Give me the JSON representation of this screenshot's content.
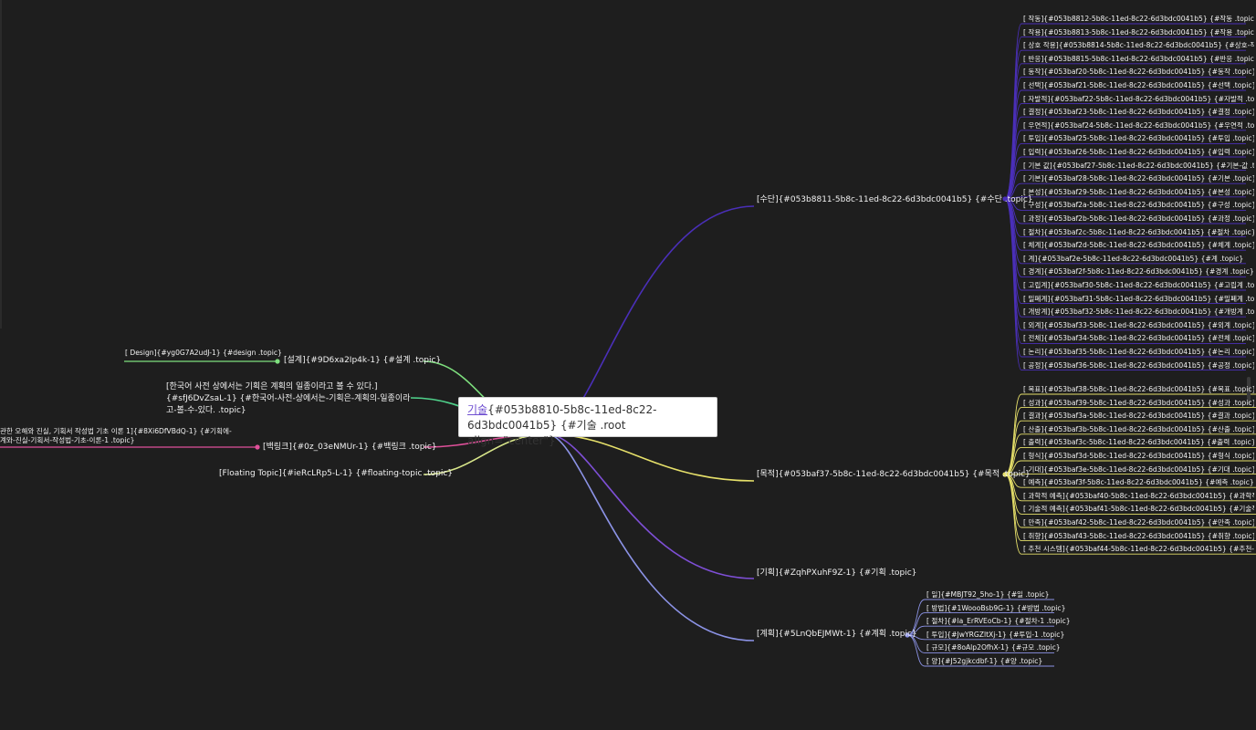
{
  "root": {
    "link_text": "기술",
    "rest": "{#053b8810-5b8c-11ed-8c22-6d3bdc0041b5} {#기술 .root align=\"center\"}"
  },
  "branches": {
    "sudan": "[수단]{#053b8811-5b8c-11ed-8c22-6d3bdc0041b5} {#수단 .topic}",
    "mokjeok": "[목적]{#053baf37-5b8c-11ed-8c22-6d3bdc0041b5} {#목적 .topic}",
    "gihoek": "[기획]{#ZqhPXuhF9Z-1} {#기획 .topic}",
    "gyehoek": "[계획]{#5LnQbEJMWt-1} {#계획 .topic}",
    "seolgye": "[설계]{#9D6xa2Ip4k-1} {#설계 .topic}",
    "design": "[ Design]{#yg0G7A2udJ-1} {#design .topic}",
    "note_line1": "[한국어 사전 상에서는 기획은 계획의 일종이라고 볼 수 있다.]",
    "note_line2": "{#sfJ6DvZsaL-1} {#한국어-사전-상에서는-기획은-계획의-일종이라",
    "note_line3": "고-볼-수-있다. .topic}",
    "baekring": "[백링크]{#0z_03eNMUr-1} {#백링크 .topic}",
    "baek_child1": "관한 오해와 진실, 기획서 작성법 기초 이론 1]{#8Xi6DfVBdQ-1} {#기획에-",
    "baek_child2": "계와-진실-기획서-작성법-기초-이론-1 .topic}",
    "floating": "[Floating Topic]{#ieRcLRp5-L-1} {#floating-topic .topic}"
  },
  "sudan_children": [
    "[ 작동]{#053b8812-5b8c-11ed-8c22-6d3bdc0041b5} {#작동 .topic}",
    "[ 작용]{#053b8813-5b8c-11ed-8c22-6d3bdc0041b5} {#작용 .topic}",
    "[ 상호 작용]{#053b8814-5b8c-11ed-8c22-6d3bdc0041b5} {#상호-작용 .tc",
    "[ 반응]{#053b8815-5b8c-11ed-8c22-6d3bdc0041b5} {#반응 .topic}",
    "[ 동작]{#053baf20-5b8c-11ed-8c22-6d3bdc0041b5} {#동작 .topic}",
    "[ 선택]{#053baf21-5b8c-11ed-8c22-6d3bdc0041b5} {#선택 .topic}",
    "[ 자발적]{#053baf22-5b8c-11ed-8c22-6d3bdc0041b5} {#자발적 .topic}",
    "[ 결정]{#053baf23-5b8c-11ed-8c22-6d3bdc0041b5} {#결정 .topic}",
    "[ 우연적]{#053baf24-5b8c-11ed-8c22-6d3bdc0041b5} {#우연적 .topic}",
    "[ 투입]{#053baf25-5b8c-11ed-8c22-6d3bdc0041b5} {#투입 .topic}",
    "[ 입력]{#053baf26-5b8c-11ed-8c22-6d3bdc0041b5} {#입력 .topic}",
    "[ 기본 값]{#053baf27-5b8c-11ed-8c22-6d3bdc0041b5} {#기본-값 .topic}",
    "[ 기본]{#053baf28-5b8c-11ed-8c22-6d3bdc0041b5} {#기본 .topic}",
    "[ 본성]{#053baf29-5b8c-11ed-8c22-6d3bdc0041b5} {#본성 .topic}",
    "[ 구성]{#053baf2a-5b8c-11ed-8c22-6d3bdc0041b5} {#구성 .topic}",
    "[ 과정]{#053baf2b-5b8c-11ed-8c22-6d3bdc0041b5} {#과정 .topic}",
    "[ 절차]{#053baf2c-5b8c-11ed-8c22-6d3bdc0041b5} {#절차 .topic}",
    "[ 체계]{#053baf2d-5b8c-11ed-8c22-6d3bdc0041b5} {#체계 .topic}",
    "[ 계]{#053baf2e-5b8c-11ed-8c22-6d3bdc0041b5} {#계 .topic}",
    "[ 경계]{#053baf2f-5b8c-11ed-8c22-6d3bdc0041b5} {#경계 .topic}",
    "[ 고립계]{#053baf30-5b8c-11ed-8c22-6d3bdc0041b5} {#고립계 .topic}",
    "[ 밀폐계]{#053baf31-5b8c-11ed-8c22-6d3bdc0041b5} {#밀폐계 .topic}",
    "[ 개방계]{#053baf32-5b8c-11ed-8c22-6d3bdc0041b5} {#개방계 .topic}",
    "[ 외계]{#053baf33-5b8c-11ed-8c22-6d3bdc0041b5} {#외계 .topic}",
    "[ 전체]{#053baf34-5b8c-11ed-8c22-6d3bdc0041b5} {#전체 .topic}",
    "[ 논리]{#053baf35-5b8c-11ed-8c22-6d3bdc0041b5} {#논리 .topic}",
    "[ 공정]{#053baf36-5b8c-11ed-8c22-6d3bdc0041b5} {#공정 .topic}"
  ],
  "mokjeok_children": [
    "[ 목표]{#053baf38-5b8c-11ed-8c22-6d3bdc0041b5} {#목표 .topic}",
    "[ 성과]{#053baf39-5b8c-11ed-8c22-6d3bdc0041b5} {#성과 .topic}",
    "[ 결과]{#053baf3a-5b8c-11ed-8c22-6d3bdc0041b5} {#결과 .topic}",
    "[ 산출]{#053baf3b-5b8c-11ed-8c22-6d3bdc0041b5} {#산출 .topic}",
    "[ 출력]{#053baf3c-5b8c-11ed-8c22-6d3bdc0041b5} {#출력 .topic}",
    "[ 형식]{#053baf3d-5b8c-11ed-8c22-6d3bdc0041b5} {#형식 .topic}",
    "[ 기대]{#053baf3e-5b8c-11ed-8c22-6d3bdc0041b5} {#기대 .topic}",
    "[ 예측]{#053baf3f-5b8c-11ed-8c22-6d3bdc0041b5} {#예측 .topic}",
    "[ 과학적 예측]{#053baf40-5b8c-11ed-8c22-6d3bdc0041b5} {#과학적-예측",
    "[ 기술적 예측]{#053baf41-5b8c-11ed-8c22-6d3bdc0041b5} {#기술적-예측",
    "[ 만족]{#053baf42-5b8c-11ed-8c22-6d3bdc0041b5} {#만족 .topic}",
    "[ 취향]{#053baf43-5b8c-11ed-8c22-6d3bdc0041b5} {#취향 .topic}",
    "[ 추천 시스템]{#053baf44-5b8c-11ed-8c22-6d3bdc0041b5} {#추천-시스템"
  ],
  "gyehoek_children": [
    "[ 일]{#MBJT92_5ho-1} {#일 .topic}",
    "[ 방법]{#1WoooBsb9G-1} {#방법 .topic}",
    "[ 절차]{#la_ErRVEoCb-1} {#절차-1 .topic}",
    "[ 투입]{#JwYRGZltXj-1} {#투입-1 .topic}",
    "[ 규모]{#8oAlp2OfhX-1} {#규모 .topic}",
    "[ 양]{#J52gjkcdbf-1} {#양 .topic}"
  ],
  "colors": {
    "background": "#1e1e1e",
    "sudan": "#4a2fb8",
    "mokjeok": "#e6e06a",
    "gihoek": "#7e4fd6",
    "gyehoek": "#8c93e6",
    "seolgye": "#7ee07e",
    "baekring": "#e0509a",
    "floating": "#d8e68a",
    "note": "#4fd08a"
  }
}
